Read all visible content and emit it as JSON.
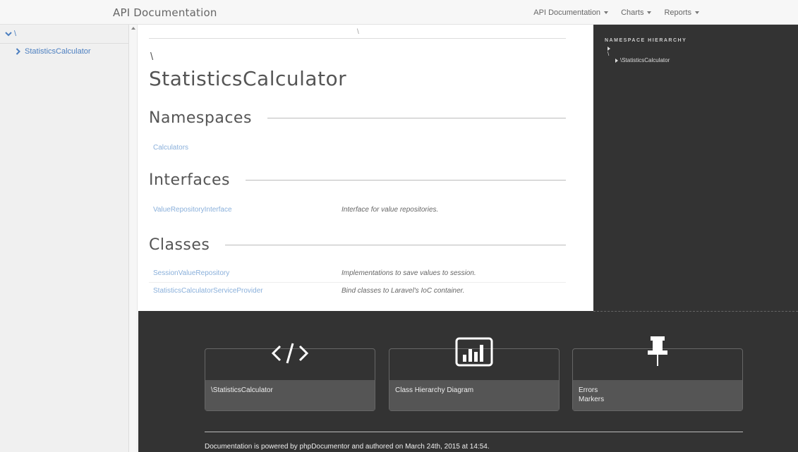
{
  "navbar": {
    "brand": "API Documentation",
    "menu": [
      {
        "label": "API Documentation"
      },
      {
        "label": "Charts"
      },
      {
        "label": "Reports"
      }
    ]
  },
  "sidebar": {
    "root_label": "\\",
    "items": [
      {
        "label": "StatisticsCalculator"
      }
    ]
  },
  "main": {
    "breadcrumb": "\\",
    "namespace_prefix": "\\",
    "title": "StatisticsCalculator",
    "namespaces": {
      "heading": "Namespaces",
      "items": [
        {
          "name": "Calculators"
        }
      ]
    },
    "interfaces": {
      "heading": "Interfaces",
      "items": [
        {
          "name": "ValueRepositoryInterface",
          "description": "Interface for value repositories."
        }
      ]
    },
    "classes": {
      "heading": "Classes",
      "items": [
        {
          "name": "SessionValueRepository",
          "description": "Implementations to save values to session."
        },
        {
          "name": "StatisticsCalculatorServiceProvider",
          "description": "Bind classes to Laravel's IoC container."
        }
      ]
    }
  },
  "right_panel": {
    "title": "NAMESPACE HIERARCHY",
    "root": "\\",
    "child": "\\StatisticsCalculator"
  },
  "footer": {
    "cards": [
      {
        "label": "\\StatisticsCalculator",
        "icon": "code-icon"
      },
      {
        "label": "Class Hierarchy Diagram",
        "icon": "bar-chart-icon"
      },
      {
        "label_line1": "Errors",
        "label_line2": "Markers",
        "icon": "pushpin-icon"
      }
    ],
    "credit": "Documentation is powered by phpDocumentor and authored on March 24th, 2015 at 14:54."
  },
  "colors": {
    "link": "#8ab0db",
    "sidebar_link": "#4c7fc0",
    "dark_panel": "#333333"
  }
}
